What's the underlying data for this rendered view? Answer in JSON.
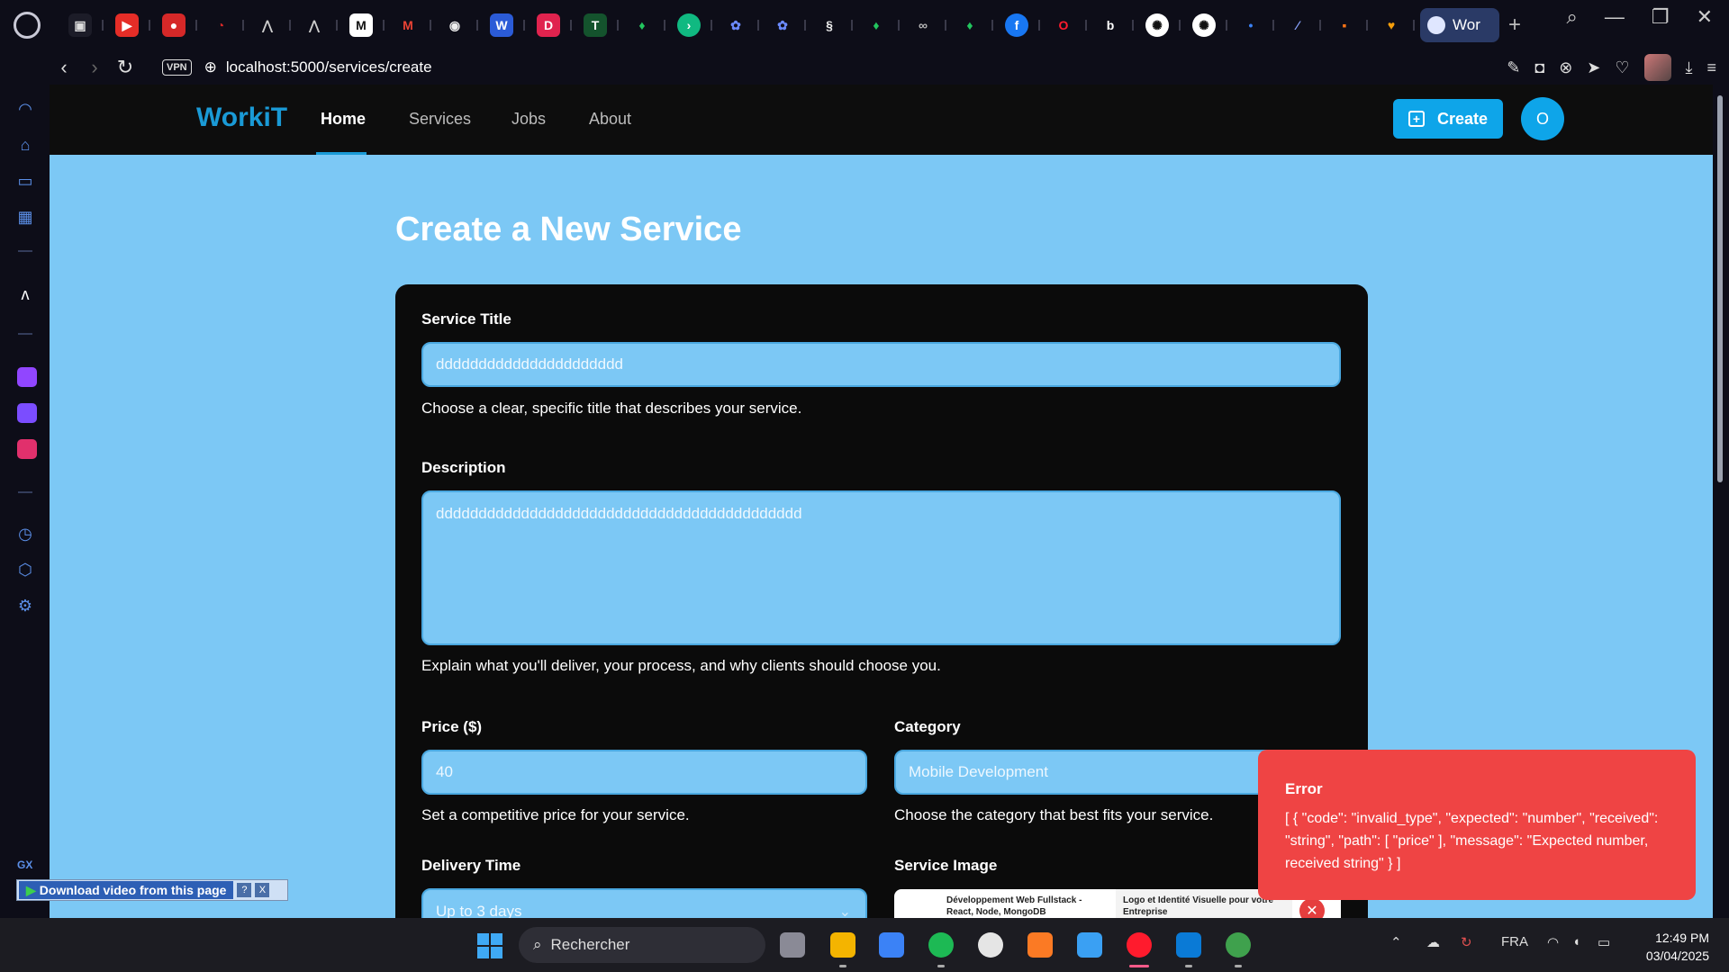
{
  "browser": {
    "active_tab_title": "Wor",
    "new_tab_icon": "plus-icon",
    "url": "localhost:5000/services/create",
    "vpn_label": "VPN"
  },
  "site": {
    "brand": "WorkiT",
    "nav": [
      {
        "label": "Home",
        "active": true
      },
      {
        "label": "Services",
        "active": false
      },
      {
        "label": "Jobs",
        "active": false
      },
      {
        "label": "About",
        "active": false
      }
    ],
    "create_button": "Create",
    "user_initial": "O"
  },
  "page": {
    "title": "Create a New Service"
  },
  "form": {
    "title": {
      "label": "Service Title",
      "value": "dddddddddddddddddddddd",
      "help": "Choose a clear, specific title that describes your service."
    },
    "description": {
      "label": "Description",
      "value": "ddddddddddddddddddddddddddddddddddddddddddd",
      "help": "Explain what you'll deliver, your process, and why clients should choose you."
    },
    "price": {
      "label": "Price ($)",
      "value": "40",
      "help": "Set a competitive price for your service."
    },
    "category": {
      "label": "Category",
      "value": "Mobile Development",
      "help": "Choose the category that best fits your service."
    },
    "delivery": {
      "label": "Delivery Time",
      "value": "Up to 3 days"
    },
    "image": {
      "label": "Service Image",
      "preview_1": "Développement Web Fullstack - React, Node, MongoDB",
      "preview_2": "Logo et Identité Visuelle pour votre Entreprise"
    }
  },
  "toast": {
    "title": "Error",
    "message": "[ { \"code\": \"invalid_type\", \"expected\": \"number\", \"received\": \"string\", \"path\": [ \"price\" ], \"message\": \"Expected number, received string\" } ]"
  },
  "download_widget": {
    "label": "Download video from this page",
    "help": "?",
    "close": "X"
  },
  "taskbar": {
    "search_placeholder": "Rechercher",
    "language": "FRA",
    "time": "12:49 PM",
    "date": "03/04/2025"
  },
  "sidebar": {
    "bottom_label": "GX"
  },
  "colors": {
    "page_bg": "#7cc8f5",
    "brand": "#1a9ad6",
    "accent": "#0ea5e9",
    "error": "#ef4444",
    "card_bg": "#0b0b0b"
  }
}
